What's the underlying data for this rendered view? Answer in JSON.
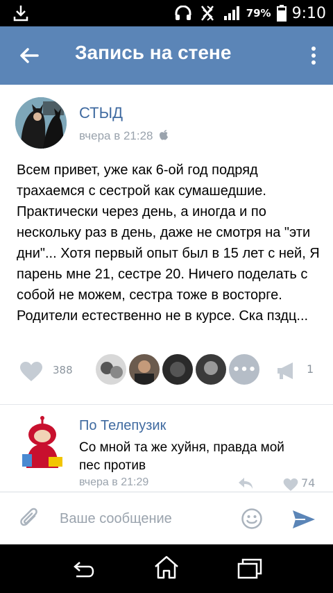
{
  "status_bar": {
    "battery_percent": "79%",
    "time": "9:10",
    "icons": [
      "download-icon",
      "headset-icon",
      "bluetooth-icon",
      "signal-icon",
      "battery-icon"
    ]
  },
  "app_bar": {
    "title": "Запись на стене",
    "back_icon": "arrow-left-icon",
    "menu_icon": "more-vert-icon"
  },
  "post": {
    "author": "СТЫД",
    "time": "вчера в 21:28",
    "platform_icon": "apple-icon",
    "text": "Всем привет, уже как 6-ой год подряд трахаемся с сестрой как сумашедшие. Практически через день, а иногда и по нескольку раз в день, даже не смотря на \"эти дни\"... Хотя первый опыт был в 15 лет с ней, Я парень мне 21, сестре 20. Ничего поделать с собой не можем, сестра тоже в восторге. Родители естественно не в курсе. Ска пздц...",
    "likes_count": "388",
    "reposts_count": "1",
    "likers_more_label": "•••"
  },
  "comment": {
    "author": "По Телепузик",
    "text": "Со мной та же хуйня, правда мой пес против",
    "time": "вчера в 21:29",
    "likes_count": "74"
  },
  "composer": {
    "placeholder": "Ваше сообщение"
  },
  "colors": {
    "app_bar": "#5b85b7",
    "link": "#3f6aa0",
    "muted": "#9aa3ad"
  }
}
